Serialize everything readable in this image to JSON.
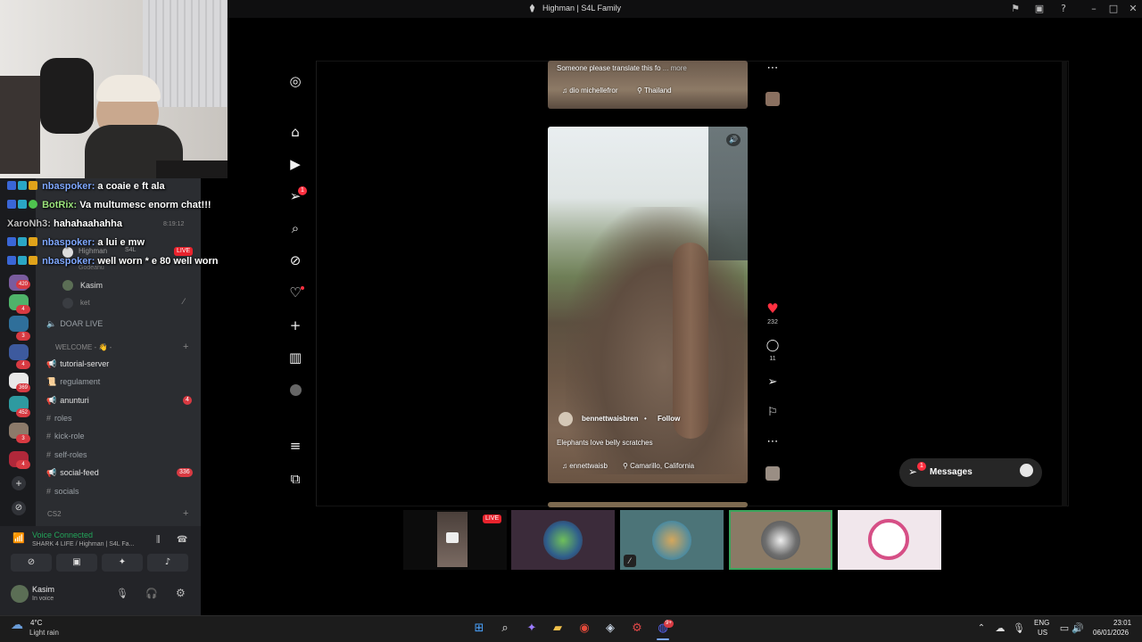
{
  "window": {
    "title": "Highman | S4L Family"
  },
  "chat": [
    {
      "user": "nbaspoker:",
      "message": "a coaie e ft ala",
      "user_color": "#7fa8ff"
    },
    {
      "user": "BotRix:",
      "message": "Va multumesc enorm chat!!!",
      "user_color": "#9be37c"
    },
    {
      "user": "XaroNh3:",
      "message": "hahahaahahha",
      "user_color": "#c0c0c0"
    },
    {
      "user": "nbaspoker:",
      "message": "a lui e mw",
      "user_color": "#7fa8ff"
    },
    {
      "user": "nbaspoker:",
      "message": "well worn * e 80 well worn",
      "user_color": "#7fa8ff"
    }
  ],
  "chat_timestamp": "8:19:12",
  "discord": {
    "server_badges": [
      "420",
      "4",
      "3",
      "4",
      "3",
      "369",
      "452",
      "3",
      "4"
    ],
    "voice_users": [
      {
        "name": "Highman",
        "tag": "S4L",
        "live": "LIVE"
      },
      {
        "name": "Godeanu"
      },
      {
        "name": "Kasim"
      },
      {
        "name": "ket"
      }
    ],
    "channels": {
      "doar_live": "DOAR LIVE",
      "welcome_category": "WELCOME - 👋 -",
      "tutorial_server": "tutorial-server",
      "regulament": "regulament",
      "anunturi": "anunturi",
      "anunturi_badge": "4",
      "roles": "roles",
      "kick_role": "kick-role",
      "self_roles": "self-roles",
      "social_feed": "social-feed",
      "social_feed_badge": "336",
      "socials": "socials",
      "cs2_category": "CS2"
    },
    "voice_panel": {
      "status": "Voice Connected",
      "channel": "SHARK 4 LIFE / Highman | S4L Fa...",
      "user_name": "Kasim",
      "user_status": "In voice"
    }
  },
  "instagram": {
    "top_reel": {
      "caption": "Someone please translate this fo",
      "more": "... more",
      "audio": "dio  michellefror",
      "location": "Thailand"
    },
    "main_reel": {
      "username": "bennettwaisbren",
      "follow": "Follow",
      "caption": "Elephants love belly scratches",
      "audio": "ennettwaisb",
      "location": "Camarillo, California",
      "likes": "232",
      "comments": "11"
    },
    "messages": {
      "label": "Messages",
      "badge": "1"
    },
    "nav_badge": "1"
  },
  "stream_strip": {
    "live_label": "LIVE"
  },
  "taskbar": {
    "weather_temp": "4°C",
    "weather_desc": "Light rain",
    "lang_top": "ENG",
    "lang_bottom": "US",
    "time": "23:01",
    "date": "06/01/2026",
    "discord_badge": "9+"
  },
  "colors": {
    "discord_bg": "#2b2d31",
    "discord_red": "#d83a42",
    "voice_green": "#23a55a",
    "ig_like": "#ff3040",
    "live_red": "#e8232d"
  }
}
